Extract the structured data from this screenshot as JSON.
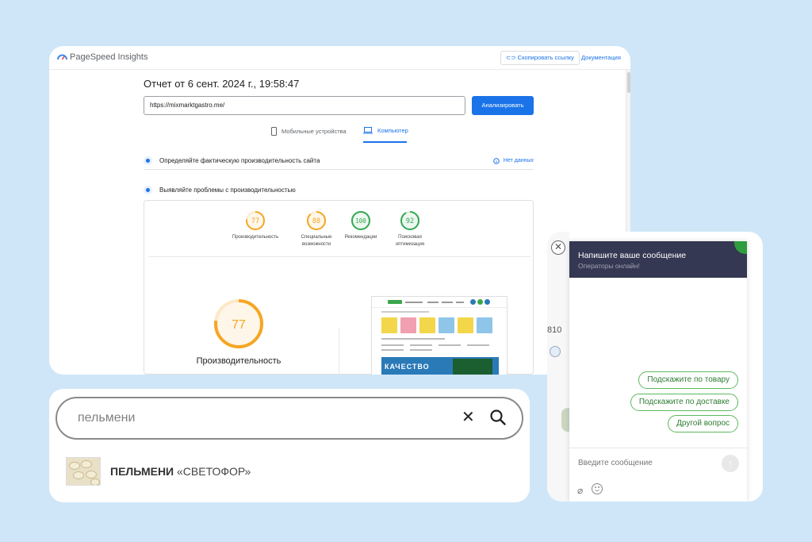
{
  "colors": {
    "background": "#cfe6f8",
    "accent_blue": "#1a73e8",
    "score_orange": "#f5a623",
    "score_green": "#34a853",
    "chat_header": "#353852",
    "chat_green": "#5cb85c"
  },
  "psi": {
    "brand": "PageSpeed Insights",
    "copy_link": "Скопировать ссылку",
    "docs_link": "Документация",
    "report_title": "Отчет от 6 сент. 2024 г., 19:58:47",
    "url_value": "https://mixmarktgastro.me/",
    "analyze_label": "Анализировать",
    "tabs": {
      "mobile": "Мобильные устройства",
      "desktop": "Компьютер"
    },
    "selected_tab": "desktop",
    "field_data_title": "Определяйте фактическую производительность сайта",
    "no_data_label": "Нет данных",
    "diagnose_title": "Выявляйте проблемы с производительностью",
    "scores": [
      {
        "value": 77,
        "label_line1": "Производительность",
        "label_line2": "",
        "color": "#f5a623"
      },
      {
        "value": 88,
        "label_line1": "Специальные",
        "label_line2": "возможности",
        "color": "#f5a623"
      },
      {
        "value": 100,
        "label_line1": "Рекомендации",
        "label_line2": "",
        "color": "#34a853"
      },
      {
        "value": 92,
        "label_line1": "Поисковая",
        "label_line2": "оптимизация",
        "color": "#34a853"
      }
    ],
    "main_score": {
      "value": 77,
      "label": "Производительность"
    },
    "thumbnail_banner": "КАЧЕСТВО"
  },
  "search": {
    "value": "пельмени",
    "result": {
      "name": "ПЕЛЬМЕНИ",
      "brand": "«СВЕТОФОР»"
    }
  },
  "chat": {
    "background_number": "810",
    "header_title": "Напишите ваше сообщение",
    "header_subtitle": "Операторы онлайн!",
    "quick_replies": [
      "Подскажите по товару",
      "Подскажите по доставке",
      "Другой вопрос"
    ],
    "input_placeholder": "Введите сообщение"
  }
}
